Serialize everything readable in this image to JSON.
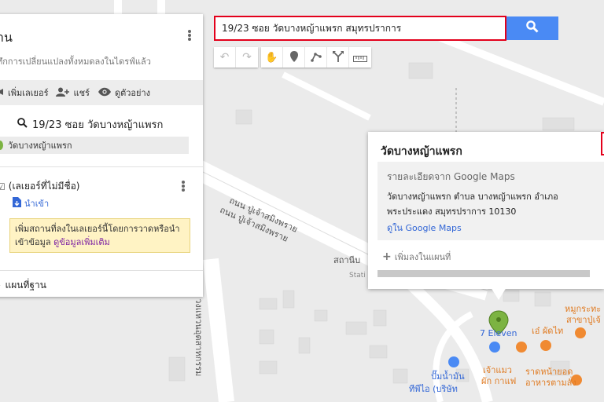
{
  "search": {
    "value": "19/23 ซอย วัดบางหญ้าแพรก สมุทรปราการ"
  },
  "panel": {
    "title": "าน",
    "saved_status": "ทึกการเปลี่ยนแปลงทั้งหมดลงในไดรฟ์แล้ว",
    "toolbar": {
      "add_layer": "เพิ่มเลเยอร์",
      "share": "แชร์",
      "preview": "ดูตัวอย่าง"
    },
    "search_result_query": "19/23 ซอย วัดบางหญ้าแพรก",
    "result_place": "วัดบางหญ้าแพรก",
    "untitled_layer": "(เลเยอร์ที่ไม่มีชื่อ)",
    "import_label": "นำเข้า",
    "tip_text": "เพิ่มสถานที่ลงในเลเยอร์นี้โดยการวาดหรือนำเข้าข้อมูล",
    "tip_link": "ดูข้อมูลเพิ่มเติม",
    "base_map": "แผนที่ฐาน"
  },
  "card": {
    "title": "วัดบางหญ้าแพรก",
    "details_header": "รายละเอียดจาก Google Maps",
    "address_line1": "วัดบางหญ้าแพรก ตำบล บางหญ้าแพรก อำเภอ",
    "address_line2": "พระประแดง สมุทรปราการ 10130",
    "view_link": "ดูใน Google Maps",
    "add_to_map": "เพิ่มลงในแผนที่"
  },
  "map_labels": {
    "road1": "ถนน ปู่เจ้าสมิงพราย",
    "road2": "ถนน ปู่เจ้าสมิงพราย",
    "road3": "ถนน วงแหวนอุตสาหกรรม",
    "station": "สถานีบ",
    "station_en": "Stati",
    "seven": "7 Eleven",
    "shop1": "หมูกระทะ",
    "shop1b": "สาขาปู่เจ้",
    "shop2": "เอ๋ ผัดไท",
    "fuel1": "ปั๊มน้ำมัน",
    "fuel2": "ทีพีไอ (บริษัท",
    "cafe1": "เจ้าแมว",
    "cafe2": "ผัก กาแฟ",
    "rest1": "ราดหน้ายอด",
    "rest2": "อาหารตามสั่ง"
  },
  "colors": {
    "search_border": "#e3001b",
    "search_button": "#4a8af4",
    "link": "#3367d6",
    "pin": "#7cb342"
  },
  "icons": [
    "search-icon",
    "undo-icon",
    "redo-icon",
    "hand-icon",
    "marker-icon",
    "line-icon",
    "directions-icon",
    "ruler-icon",
    "add-layer-icon",
    "share-icon",
    "eye-icon",
    "import-icon",
    "plus-icon"
  ]
}
